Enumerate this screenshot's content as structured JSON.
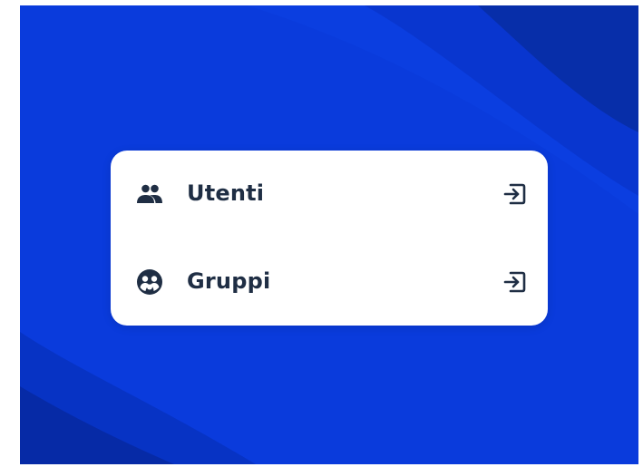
{
  "menu": {
    "items": [
      {
        "label": "Utenti",
        "icon": "users-icon",
        "action_icon": "login-arrow-icon"
      },
      {
        "label": "Gruppi",
        "icon": "group-icon",
        "action_icon": "login-arrow-icon"
      }
    ]
  },
  "colors": {
    "background_primary": "#0a3bdc",
    "background_dark": "#062aa6",
    "card": "#ffffff",
    "text": "#1f2e44"
  }
}
